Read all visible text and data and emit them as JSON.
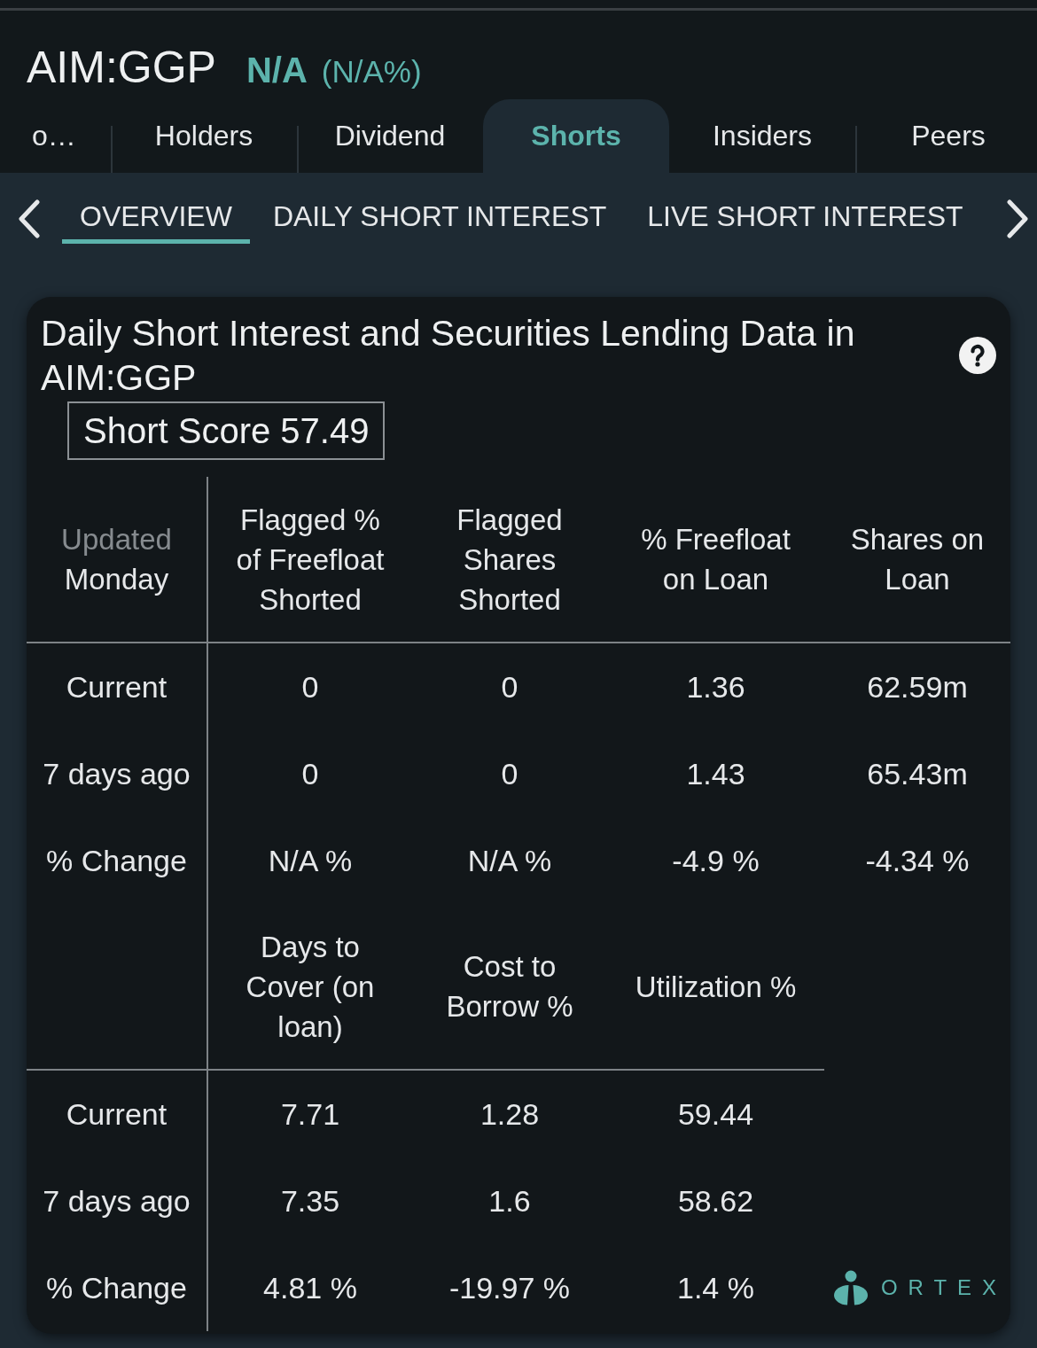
{
  "header": {
    "symbol": "AIM:GGP",
    "price": "N/A",
    "change": "(N/A%)"
  },
  "tabs": [
    {
      "label": "o…",
      "selected": false
    },
    {
      "label": "Holders",
      "selected": false
    },
    {
      "label": "Dividend",
      "selected": false
    },
    {
      "label": "Shorts",
      "selected": true
    },
    {
      "label": "Insiders",
      "selected": false
    },
    {
      "label": "Peers",
      "selected": false
    }
  ],
  "subtabs": [
    {
      "label": "OVERVIEW",
      "selected": true
    },
    {
      "label": "DAILY SHORT INTEREST",
      "selected": false
    },
    {
      "label": "LIVE SHORT INTEREST",
      "selected": false
    }
  ],
  "card": {
    "title": "Daily Short Interest and Securities Lending Data in AIM:GGP",
    "short_score": "Short Score 57.49",
    "tables": [
      {
        "corner": {
          "label": "Updated",
          "day": "Monday"
        },
        "columns": [
          "Flagged % of Freefloat Shorted",
          "Flagged Shares Shorted",
          "% Freefloat on Loan",
          "Shares on Loan"
        ],
        "rows": [
          {
            "label": "Current",
            "cells": [
              "0",
              "0",
              "1.36",
              "62.59m"
            ]
          },
          {
            "label": "7 days ago",
            "cells": [
              "0",
              "0",
              "1.43",
              "65.43m"
            ]
          },
          {
            "label": "% Change",
            "cells": [
              "N/A %",
              "N/A %",
              "-4.9 %",
              "-4.34 %"
            ]
          }
        ]
      },
      {
        "columns": [
          "Days to Cover (on loan)",
          "Cost to Borrow %",
          "Utilization %"
        ],
        "rows": [
          {
            "label": "Current",
            "cells": [
              "7.71",
              "1.28",
              "59.44"
            ]
          },
          {
            "label": "7 days ago",
            "cells": [
              "7.35",
              "1.6",
              "58.62"
            ]
          },
          {
            "label": "% Change",
            "cells": [
              "4.81 %",
              "-19.97 %",
              "1.4 %"
            ]
          }
        ]
      }
    ],
    "logo": {
      "text": "ORTEX"
    }
  }
}
